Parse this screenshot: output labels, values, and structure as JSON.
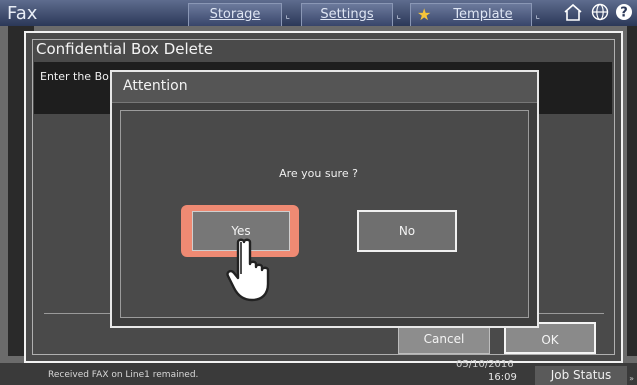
{
  "app": {
    "title": "Fax"
  },
  "header": {
    "tabs": [
      {
        "label": "Storage"
      },
      {
        "label": "Settings"
      },
      {
        "label": "Template"
      }
    ],
    "icons": [
      "star-icon",
      "home-icon",
      "globe-icon",
      "help-icon"
    ]
  },
  "dialog": {
    "title": "Confidential Box Delete",
    "instruction": "Enter the Bo",
    "cancel_label": "Cancel",
    "ok_label": "OK"
  },
  "attention": {
    "title": "Attention",
    "question": "Are you sure ?",
    "yes_label": "Yes",
    "no_label": "No"
  },
  "status": {
    "message": "Received FAX on Line1 remained.",
    "date": "05/10/2016",
    "time": "16:09",
    "job_status_label": "Job Status"
  },
  "colors": {
    "header": "#2b3858",
    "highlight": "#ef8a73",
    "dialog_bg": "#4a4a4a"
  }
}
